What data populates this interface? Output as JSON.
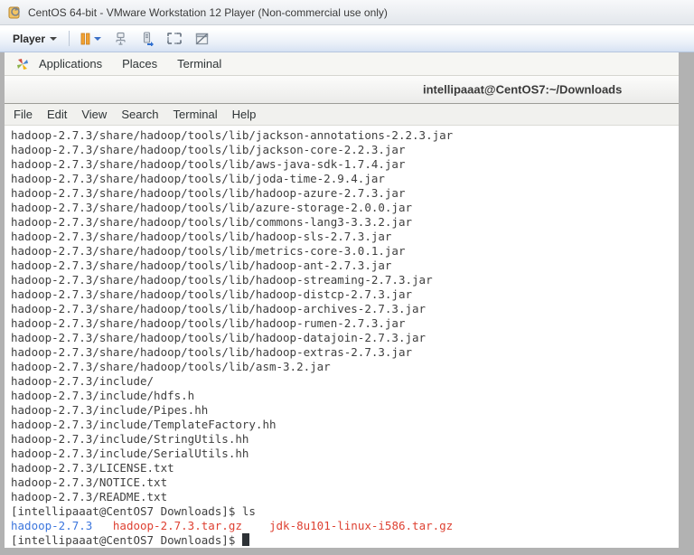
{
  "vmware": {
    "window_title": "CentOS 64-bit - VMware Workstation 12 Player (Non-commercial use only)",
    "toolbar": {
      "player_label": "Player",
      "icons": [
        "pause-icon",
        "send-ctrl-alt-del-icon",
        "devices-icon",
        "fullscreen-icon",
        "unity-icon"
      ]
    }
  },
  "desktop": {
    "panel": {
      "menus": [
        "Applications",
        "Places",
        "Terminal"
      ],
      "logo": "centos-applications-icon"
    }
  },
  "terminal_window": {
    "title": "intellipaaat@CentOS7:~/Downloads",
    "menu_items": [
      "File",
      "Edit",
      "View",
      "Search",
      "Terminal",
      "Help"
    ]
  },
  "terminal": {
    "colors": {
      "blue": "#3c76dd",
      "red": "#de4132"
    },
    "lines": [
      {
        "text": "hadoop-2.7.3/share/hadoop/tools/lib/jackson-annotations-2.2.3.jar"
      },
      {
        "text": "hadoop-2.7.3/share/hadoop/tools/lib/jackson-core-2.2.3.jar"
      },
      {
        "text": "hadoop-2.7.3/share/hadoop/tools/lib/aws-java-sdk-1.7.4.jar"
      },
      {
        "text": "hadoop-2.7.3/share/hadoop/tools/lib/joda-time-2.9.4.jar"
      },
      {
        "text": "hadoop-2.7.3/share/hadoop/tools/lib/hadoop-azure-2.7.3.jar"
      },
      {
        "text": "hadoop-2.7.3/share/hadoop/tools/lib/azure-storage-2.0.0.jar"
      },
      {
        "text": "hadoop-2.7.3/share/hadoop/tools/lib/commons-lang3-3.3.2.jar"
      },
      {
        "text": "hadoop-2.7.3/share/hadoop/tools/lib/hadoop-sls-2.7.3.jar"
      },
      {
        "text": "hadoop-2.7.3/share/hadoop/tools/lib/metrics-core-3.0.1.jar"
      },
      {
        "text": "hadoop-2.7.3/share/hadoop/tools/lib/hadoop-ant-2.7.3.jar"
      },
      {
        "text": "hadoop-2.7.3/share/hadoop/tools/lib/hadoop-streaming-2.7.3.jar"
      },
      {
        "text": "hadoop-2.7.3/share/hadoop/tools/lib/hadoop-distcp-2.7.3.jar"
      },
      {
        "text": "hadoop-2.7.3/share/hadoop/tools/lib/hadoop-archives-2.7.3.jar"
      },
      {
        "text": "hadoop-2.7.3/share/hadoop/tools/lib/hadoop-rumen-2.7.3.jar"
      },
      {
        "text": "hadoop-2.7.3/share/hadoop/tools/lib/hadoop-datajoin-2.7.3.jar"
      },
      {
        "text": "hadoop-2.7.3/share/hadoop/tools/lib/hadoop-extras-2.7.3.jar"
      },
      {
        "text": "hadoop-2.7.3/share/hadoop/tools/lib/asm-3.2.jar"
      },
      {
        "text": "hadoop-2.7.3/include/"
      },
      {
        "text": "hadoop-2.7.3/include/hdfs.h"
      },
      {
        "text": "hadoop-2.7.3/include/Pipes.hh"
      },
      {
        "text": "hadoop-2.7.3/include/TemplateFactory.hh"
      },
      {
        "text": "hadoop-2.7.3/include/StringUtils.hh"
      },
      {
        "text": "hadoop-2.7.3/include/SerialUtils.hh"
      },
      {
        "text": "hadoop-2.7.3/LICENSE.txt"
      },
      {
        "text": "hadoop-2.7.3/NOTICE.txt"
      },
      {
        "text": "hadoop-2.7.3/README.txt"
      },
      {
        "text": "[intellipaaat@CentOS7 Downloads]$ ls"
      },
      {
        "segments": [
          {
            "text": "hadoop-2.7.3",
            "color": "blue"
          },
          {
            "text": "   "
          },
          {
            "text": "hadoop-2.7.3.tar.gz",
            "color": "red"
          },
          {
            "text": "    "
          },
          {
            "text": "jdk-8u101-linux-i586.tar.gz",
            "color": "red"
          }
        ]
      },
      {
        "text": "[intellipaaat@CentOS7 Downloads]$ ",
        "cursor": true
      }
    ]
  }
}
